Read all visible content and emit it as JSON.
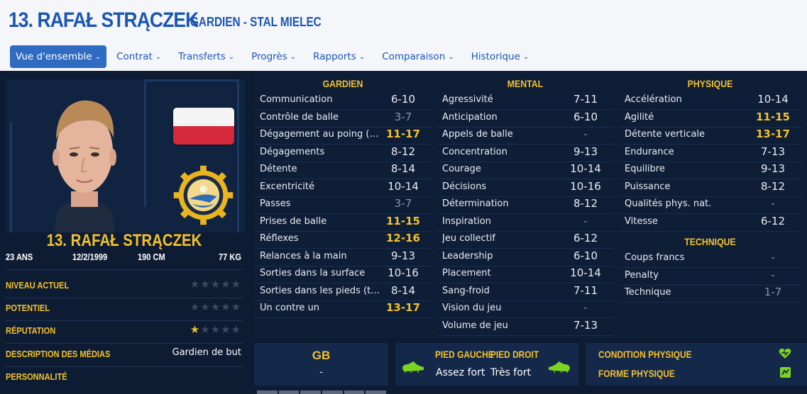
{
  "header": {
    "title": "13. RAFAŁ STRĄCZEK",
    "subtitle": "GARDIEN - STAL MIELEC",
    "colors": {
      "accent": "#1a56b4",
      "gold": "#f2c12e",
      "background": "#0e1c33"
    }
  },
  "tabs": [
    {
      "label": "Vue d'ensemble",
      "active": true
    },
    {
      "label": "Contrat"
    },
    {
      "label": "Transferts"
    },
    {
      "label": "Progrès"
    },
    {
      "label": "Rapports"
    },
    {
      "label": "Comparaison"
    },
    {
      "label": "Historique"
    }
  ],
  "profile": {
    "name": "13. RAFAŁ STRĄCZEK",
    "age": "23 ANS",
    "dob": "12/2/1999",
    "height": "190 CM",
    "weight": "77 KG",
    "flag": "poland-flag",
    "club_badge": "stal-mielec-badge",
    "rows": [
      {
        "label": "NIVEAU ACTUEL",
        "stars": 0
      },
      {
        "label": "POTENTIEL",
        "stars": 0
      },
      {
        "label": "RÉPUTATION",
        "stars": 1
      },
      {
        "label": "DESCRIPTION DES MÉDIAS",
        "value": "Gardien de but"
      },
      {
        "label": "PERSONNALITÉ",
        "value": ""
      }
    ]
  },
  "attributes": {
    "gardien": {
      "heading": "GARDIEN",
      "items": [
        {
          "name": "Communication",
          "value": "6-10",
          "style": "normal"
        },
        {
          "name": "Contrôle de balle",
          "value": "3-7",
          "style": "low"
        },
        {
          "name": "Dégagement au poing (tend...",
          "value": "11-17",
          "style": "high"
        },
        {
          "name": "Dégagements",
          "value": "8-12",
          "style": "normal"
        },
        {
          "name": "Détente",
          "value": "8-14",
          "style": "normal"
        },
        {
          "name": "Excentricité",
          "value": "10-14",
          "style": "normal"
        },
        {
          "name": "Passes",
          "value": "3-7",
          "style": "low"
        },
        {
          "name": "Prises de balle",
          "value": "11-15",
          "style": "high"
        },
        {
          "name": "Réflexes",
          "value": "12-16",
          "style": "high"
        },
        {
          "name": "Relances à la main",
          "value": "9-13",
          "style": "normal"
        },
        {
          "name": "Sorties dans la surface",
          "value": "10-16",
          "style": "normal"
        },
        {
          "name": "Sorties dans les pieds (ten...",
          "value": "8-14",
          "style": "normal"
        },
        {
          "name": "Un contre un",
          "value": "13-17",
          "style": "high"
        }
      ]
    },
    "mental": {
      "heading": "MENTAL",
      "items": [
        {
          "name": "Agressivité",
          "value": "7-11",
          "style": "normal"
        },
        {
          "name": "Anticipation",
          "value": "6-10",
          "style": "normal"
        },
        {
          "name": "Appels de balle",
          "value": "-",
          "style": "dash"
        },
        {
          "name": "Concentration",
          "value": "9-13",
          "style": "normal"
        },
        {
          "name": "Courage",
          "value": "10-14",
          "style": "normal"
        },
        {
          "name": "Décisions",
          "value": "10-16",
          "style": "normal"
        },
        {
          "name": "Détermination",
          "value": "8-12",
          "style": "normal"
        },
        {
          "name": "Inspiration",
          "value": "-",
          "style": "dash"
        },
        {
          "name": "Jeu collectif",
          "value": "6-12",
          "style": "normal"
        },
        {
          "name": "Leadership",
          "value": "6-10",
          "style": "normal"
        },
        {
          "name": "Placement",
          "value": "10-14",
          "style": "normal"
        },
        {
          "name": "Sang-froid",
          "value": "7-11",
          "style": "normal"
        },
        {
          "name": "Vision du jeu",
          "value": "-",
          "style": "dash"
        },
        {
          "name": "Volume de jeu",
          "value": "7-13",
          "style": "normal"
        }
      ]
    },
    "physique": {
      "heading": "PHYSIQUE",
      "items": [
        {
          "name": "Accélération",
          "value": "10-14",
          "style": "normal"
        },
        {
          "name": "Agilité",
          "value": "11-15",
          "style": "high"
        },
        {
          "name": "Détente verticale",
          "value": "13-17",
          "style": "high"
        },
        {
          "name": "Endurance",
          "value": "7-13",
          "style": "normal"
        },
        {
          "name": "Équilibre",
          "value": "9-13",
          "style": "normal"
        },
        {
          "name": "Puissance",
          "value": "8-12",
          "style": "normal"
        },
        {
          "name": "Qualités phys. nat.",
          "value": "-",
          "style": "dash"
        },
        {
          "name": "Vitesse",
          "value": "6-12",
          "style": "normal"
        }
      ]
    },
    "technique": {
      "heading": "TECHNIQUE",
      "items": [
        {
          "name": "Coups francs",
          "value": "-",
          "style": "dash"
        },
        {
          "name": "Penalty",
          "value": "-",
          "style": "dash"
        },
        {
          "name": "Technique",
          "value": "1-7",
          "style": "low"
        }
      ]
    }
  },
  "position": {
    "label": "GB",
    "value": "-"
  },
  "feet": {
    "left_label": "PIED GAUCHE",
    "left_value": "Assez fort",
    "right_label": "PIED DROIT",
    "right_value": "Très fort"
  },
  "condition": {
    "condition_label": "CONDITION PHYSIQUE",
    "form_label": "FORME PHYSIQUE",
    "condition_icon": "heart-icon",
    "form_icon": "fitness-icon"
  }
}
